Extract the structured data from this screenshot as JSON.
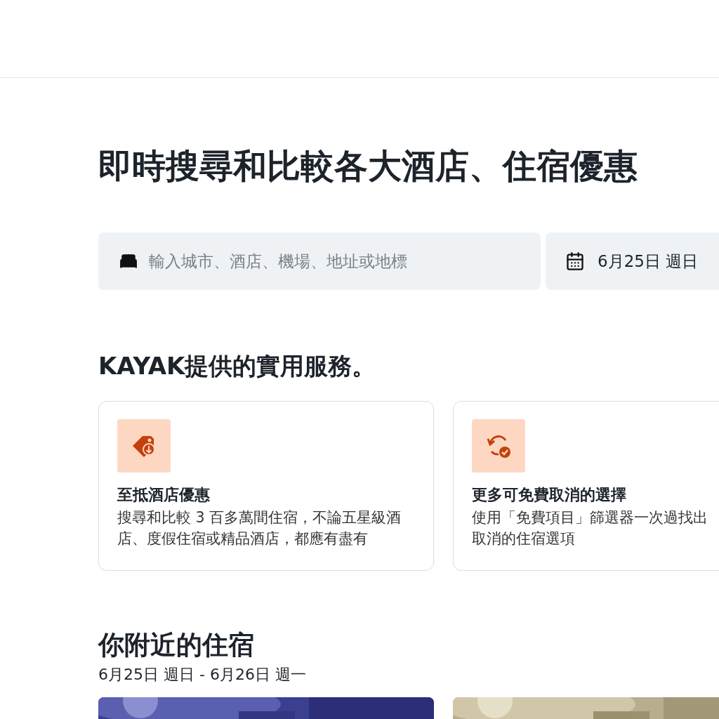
{
  "hero": {
    "title": "即時搜尋和比較各大酒店、住宿優惠"
  },
  "search": {
    "placeholder": "輸入城市、酒店、機場、地址或地標",
    "date": "6月25日 週日"
  },
  "services": {
    "heading": "KAYAK提供的實用服務。",
    "cards": [
      {
        "kind": "tag",
        "title": "至抵酒店優惠",
        "lines": [
          "搜尋和比較 3 百多萬間住宿，不論五星級酒",
          "店、度假住宿或精品酒店，都應有盡有"
        ]
      },
      {
        "kind": "cancel",
        "title": "更多可免費取消的選擇",
        "lines": [
          "使用「免費項目」篩選器一次過找出",
          "取消的住宿選項"
        ]
      }
    ]
  },
  "nearby": {
    "heading": "你附近的住宿",
    "dates": "6月25日 週日 - 6月26日 週一"
  }
}
